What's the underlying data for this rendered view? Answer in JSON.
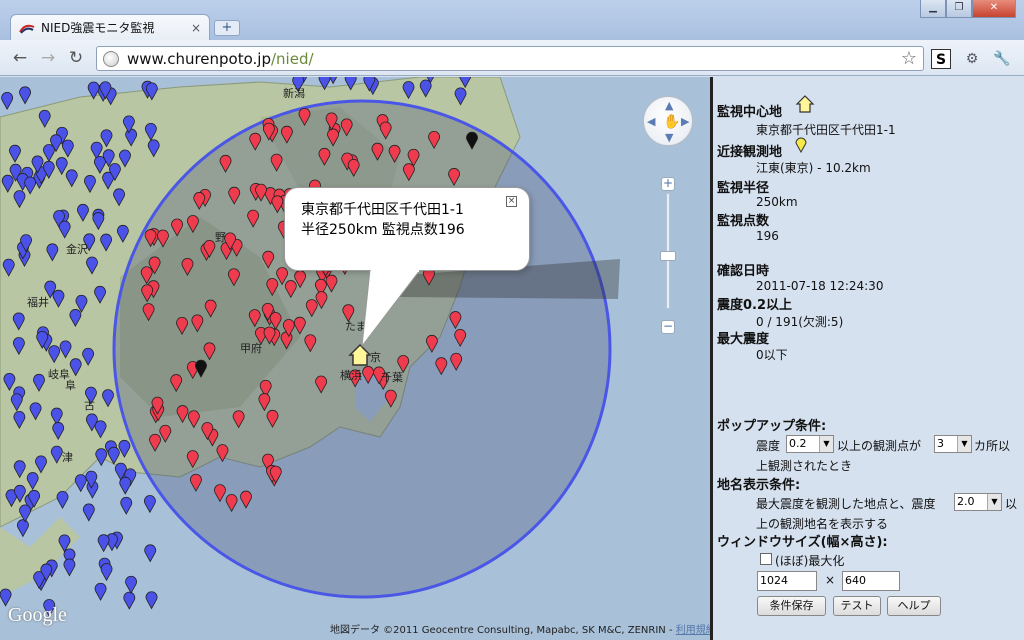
{
  "browser": {
    "tab_title": "NIED強震モニタ監視",
    "tab_close": "×",
    "newtab": "+",
    "url_domain": "www.churenpoto.jp",
    "url_path": "/nied/",
    "back_icon": "back-arrow-icon",
    "forward_icon": "forward-arrow-icon",
    "reload_icon": "reload-icon",
    "star_icon": "bookmark-star-icon"
  },
  "map": {
    "bubble": {
      "line1": "東京都千代田区千代田1-1",
      "line2": "半径250km 監視点数196",
      "close": "×"
    },
    "place_labels": [
      "新潟",
      "福井",
      "岐阜",
      "甲府",
      "たま",
      "京",
      "横浜",
      "千葉",
      "金沢",
      "野",
      "阜",
      "古",
      "津"
    ],
    "copyright": "地図データ ©2011 Geocentre Consulting, Mapabc, SK M&C, ZENRIN - ",
    "terms": "利用規約",
    "logo": "Google",
    "colors": {
      "circle_stroke": "#4a57e6",
      "pin_red": "#ef3b4e",
      "pin_blue": "#4b52e8",
      "pin_black": "#111111",
      "sea": "#a8c0d8"
    }
  },
  "panel": {
    "center_label": "監視中心地",
    "center_value": "東京都千代田区千代田1-1",
    "nearby_label": "近接観測地",
    "nearby_value": "江東(東京) - 10.2km",
    "radius_label": "監視半径",
    "radius_value": "250km",
    "points_label": "監視点数",
    "points_value": "196",
    "checked_label": "確認日時",
    "checked_value": "2011-07-18 12:24:30",
    "intensity_label": "震度0.2以上",
    "intensity_value": "0 / 191(欠測:5)",
    "max_label": "最大震度",
    "max_value": "0以下",
    "popup_label": "ポップアップ条件:",
    "popup_text1": "震度",
    "popup_select1": "0.2",
    "popup_text2": "以上の観測点が",
    "popup_select2": "3",
    "popup_text3": "カ所以",
    "popup_text4": "上観測されたとき",
    "placename_label": "地名表示条件:",
    "placename_text1": "最大震度を観測した地点と、震度",
    "placename_select": "2.0",
    "placename_text2": "以",
    "placename_text3": "上の観測地名を表示する",
    "window_label": "ウィンドウサイズ(幅×高さ):",
    "maximize_label": "(ほぼ)最大化",
    "width_value": "1024",
    "times": "×",
    "height_value": "640",
    "save_button": "条件保存",
    "test_button": "テスト",
    "help_button": "ヘルプ"
  }
}
